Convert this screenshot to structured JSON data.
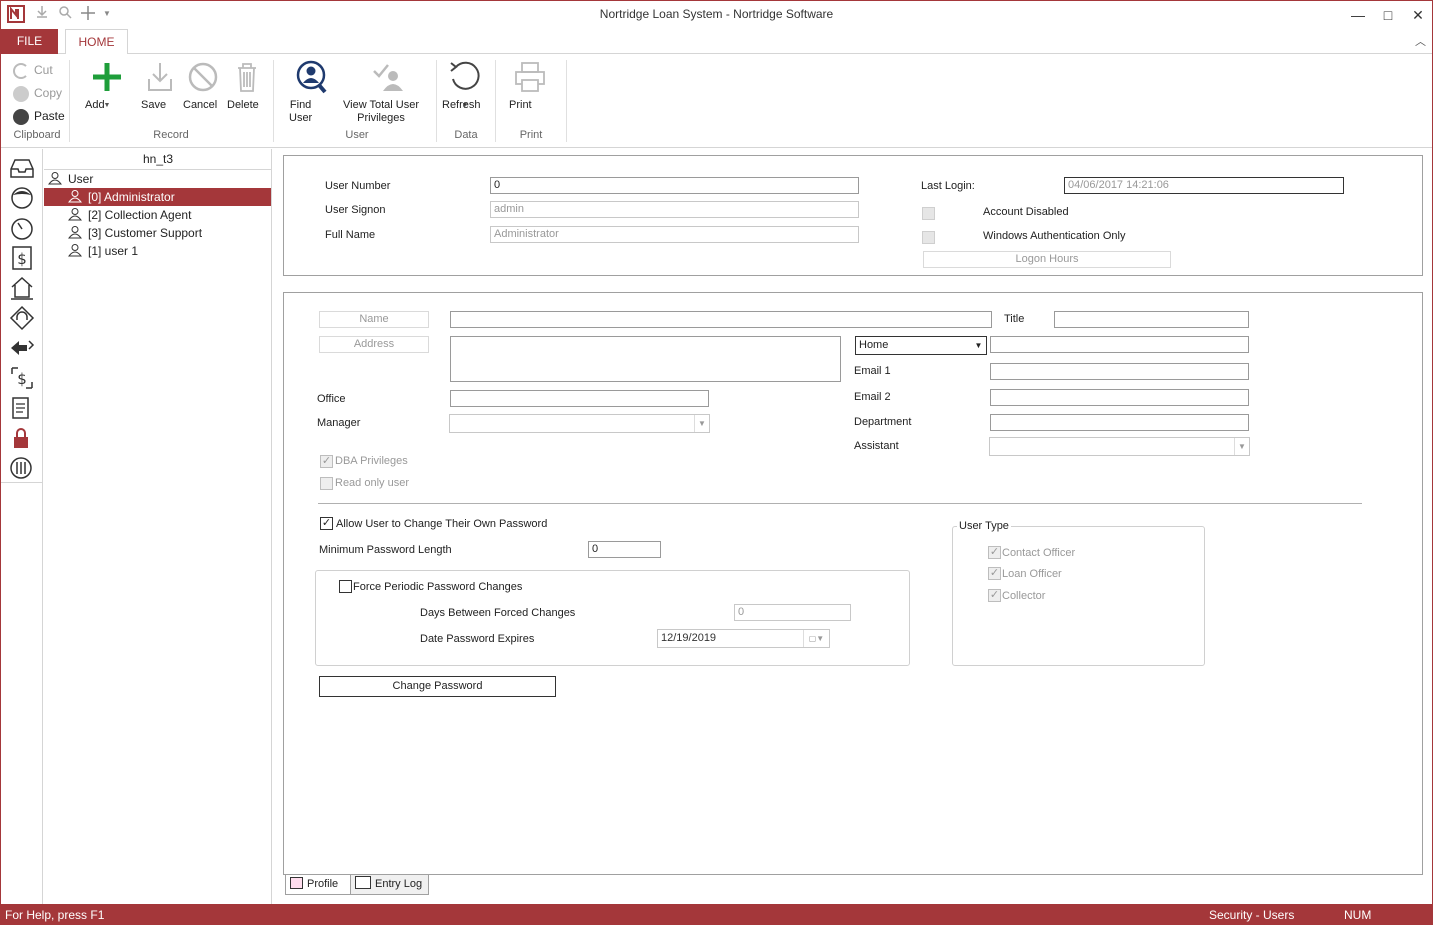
{
  "window": {
    "title": "Nortridge Loan System - Nortridge Software",
    "minimize": "—",
    "maximize": "□",
    "close": "✕"
  },
  "ribbon": {
    "tabs": {
      "file": "FILE",
      "home": "HOME"
    },
    "clipboard": {
      "cut": "Cut",
      "copy": "Copy",
      "paste": "Paste",
      "group": "Clipboard"
    },
    "record": {
      "add": "Add",
      "save": "Save",
      "cancel": "Cancel",
      "delete": "Delete",
      "group": "Record"
    },
    "user": {
      "find": "Find\nUser",
      "view_priv": "View Total User\nPrivileges",
      "group": "User"
    },
    "data": {
      "refresh": "Refresh",
      "group": "Data"
    },
    "print": {
      "print": "Print",
      "group": "Print"
    }
  },
  "tree": {
    "header": "hn_t3",
    "root": "User",
    "items": [
      {
        "label": "[0] Administrator",
        "selected": true
      },
      {
        "label": "[2] Collection Agent",
        "selected": false
      },
      {
        "label": "[3] Customer Support",
        "selected": false
      },
      {
        "label": "[1] user  1",
        "selected": false
      }
    ]
  },
  "user_info": {
    "user_number_label": "User Number",
    "user_number": "0",
    "user_signon_label": "User Signon",
    "user_signon": "admin",
    "full_name_label": "Full Name",
    "full_name": "Administrator",
    "last_login_label": "Last Login:",
    "last_login": "04/06/2017 14:21:06",
    "account_disabled": "Account Disabled",
    "windows_auth": "Windows Authentication Only",
    "logon_hours": "Logon Hours"
  },
  "details": {
    "name_btn": "Name",
    "address_btn": "Address",
    "title_label": "Title",
    "phone_type": "Home",
    "email1_label": "Email 1",
    "email2_label": "Email 2",
    "office_label": "Office",
    "department_label": "Department",
    "manager_label": "Manager",
    "assistant_label": "Assistant",
    "dba_privileges": "DBA Privileges",
    "read_only": "Read only user"
  },
  "password": {
    "allow_change": "Allow User to Change Their Own Password",
    "min_length_label": "Minimum Password Length",
    "min_length": "0",
    "force_periodic": "Force Periodic Password Changes",
    "days_between_label": "Days Between Forced Changes",
    "days_between": "0",
    "date_expires_label": "Date Password Expires",
    "date_expires": "12/19/2019",
    "change_password": "Change Password"
  },
  "user_type": {
    "title": "User Type",
    "contact_officer": "Contact Officer",
    "loan_officer": "Loan Officer",
    "collector": "Collector"
  },
  "bottom_tabs": {
    "profile": "Profile",
    "entry_log": "Entry Log"
  },
  "status": {
    "help": "For Help, press F1",
    "context": "Security - Users",
    "num": "NUM"
  },
  "colors": {
    "accent": "#a4373a",
    "add_green": "#1e9e3a"
  }
}
